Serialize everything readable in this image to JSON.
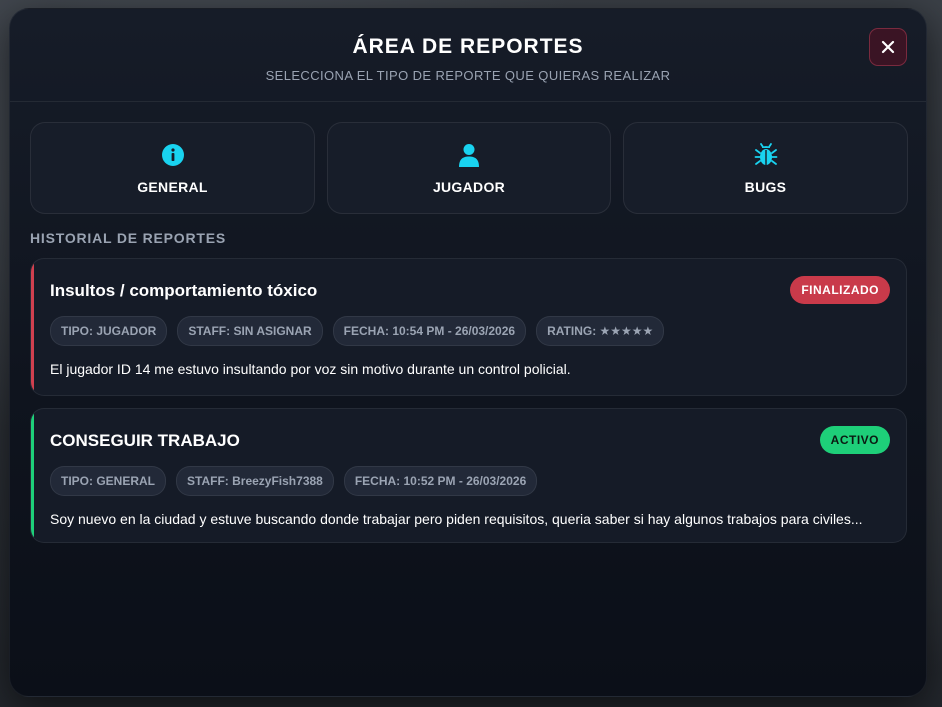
{
  "header": {
    "title": "ÁREA DE REPORTES",
    "subtitle": "SELECCIONA EL TIPO DE REPORTE QUE QUIERAS REALIZAR",
    "close_icon": "close-icon"
  },
  "report_types": [
    {
      "label": "GENERAL",
      "icon": "info-icon"
    },
    {
      "label": "JUGADOR",
      "icon": "user-icon"
    },
    {
      "label": "BUGS",
      "icon": "bug-icon"
    }
  ],
  "history": {
    "heading": "HISTORIAL DE REPORTES",
    "reports": [
      {
        "title": "Insultos / comportamiento tóxico",
        "status": "FINALIZADO",
        "status_color": "#d0404f",
        "tipo": "TIPO: JUGADOR",
        "staff": "STAFF: SIN ASIGNAR",
        "fecha": "FECHA: 10:54 PM - 26/03/2026",
        "rating": "RATING: ★★★★★",
        "description": "El jugador ID 14 me estuvo insultando por voz sin motivo durante un control policial."
      },
      {
        "title": "CONSEGUIR TRABAJO",
        "status": "ACTIVO",
        "status_color": "#1ed07a",
        "tipo": "TIPO: GENERAL",
        "staff": "STAFF: BreezyFish7388",
        "fecha": "FECHA: 10:52 PM - 26/03/2026",
        "description": "Soy nuevo en la ciudad y estuve buscando donde trabajar pero piden requisitos, queria saber si hay algunos trabajos para civiles..."
      }
    ]
  },
  "colors": {
    "accent_icon": "#19d3f0",
    "finalizado": "#d0404f",
    "activo": "#1ed07a"
  }
}
